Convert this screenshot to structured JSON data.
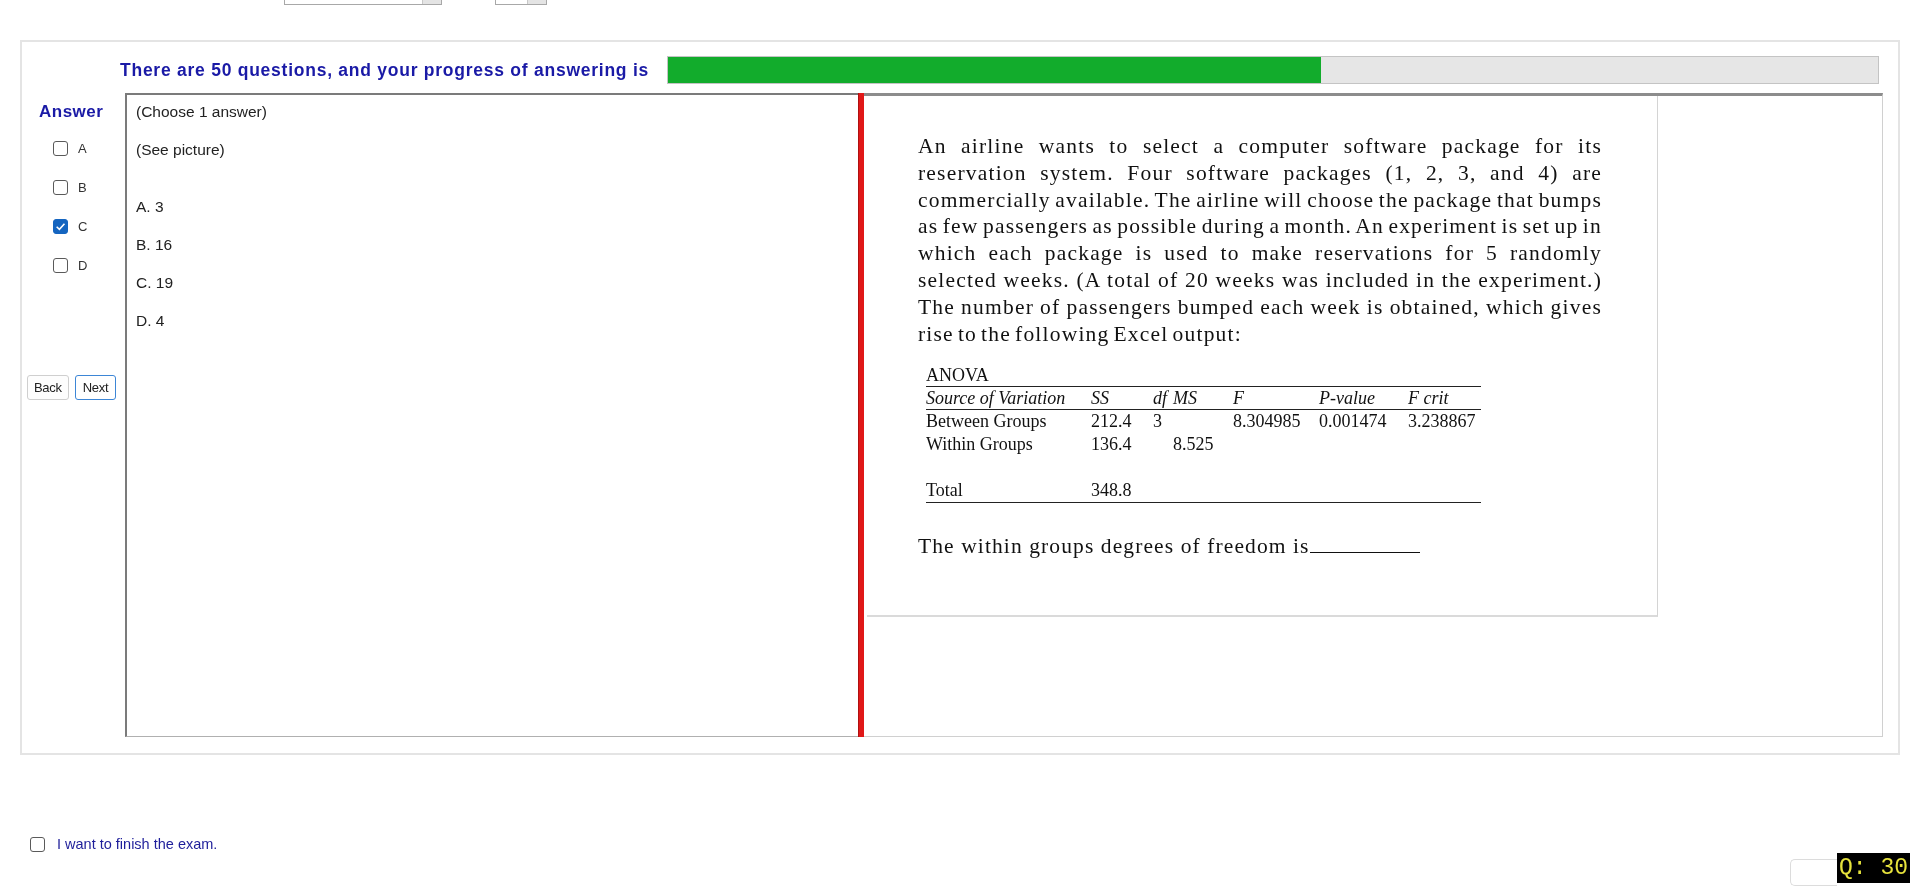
{
  "progress": {
    "text": "There are 50 questions, and your progress of answering is",
    "level": 0.54
  },
  "answer_panel": {
    "title": "Answer",
    "options": [
      {
        "label": "A",
        "checked": false
      },
      {
        "label": "B",
        "checked": false
      },
      {
        "label": "C",
        "checked": true
      },
      {
        "label": "D",
        "checked": false
      }
    ]
  },
  "navigation": {
    "buttons": [
      {
        "label": "Back",
        "focused": false
      },
      {
        "label": "Next",
        "focused": true
      }
    ]
  },
  "answer_box": {
    "lines": [
      "(Choose 1 answer)",
      "(See picture)"
    ],
    "choices": [
      "A. 3",
      "B. 16",
      "C. 19",
      "D. 4"
    ]
  },
  "question": {
    "paragraph": "An airline wants to select a computer software package for its reservation system. Four software packages (1, 2, 3, and 4) are commercially available. The airline will choose the package that bumps as few passengers as possible during a month. An experiment is set up in which each package is used to make reservations for 5 randomly selected weeks. (A total of 20 weeks was included in the experiment.) The number of passengers bumped each week is obtained, which gives rise to the following Excel output:",
    "table": {
      "title": "ANOVA",
      "columns": [
        "Source of Variation",
        "SS",
        "df",
        "MS",
        "F",
        "P-value",
        "F crit"
      ],
      "rows": [
        {
          "kind": "group",
          "cells": [
            "Between Groups",
            "212.4",
            "3",
            null,
            "8.304985",
            "0.001474",
            "3.238867"
          ]
        },
        {
          "kind": "group",
          "cells": [
            "Within Groups",
            "136.4",
            null,
            "8.525",
            null,
            null,
            null
          ]
        },
        {
          "kind": "total",
          "cells": [
            "Total",
            "348.8",
            null,
            null,
            null,
            null,
            null
          ]
        }
      ]
    },
    "prompt": "The within groups degrees of freedom is"
  },
  "finish": {
    "label": "I want to finish the exam.",
    "checked": false
  },
  "question_badge": "Q: 30"
}
